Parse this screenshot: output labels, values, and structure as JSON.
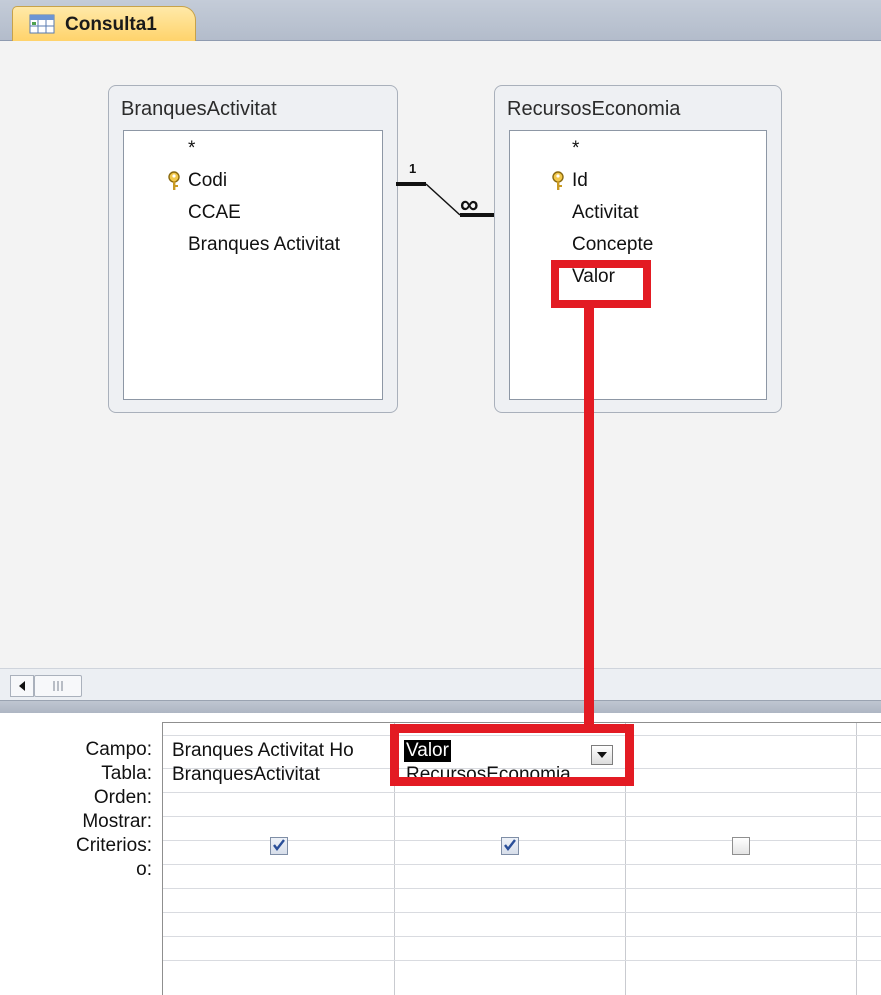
{
  "tab": {
    "title": "Consulta1"
  },
  "tables": [
    {
      "name": "BranquesActivitat",
      "fields": [
        "*",
        "Codi",
        "CCAE",
        "Branques Activitat"
      ],
      "key_field": "Codi"
    },
    {
      "name": "RecursosEconomia",
      "fields": [
        "*",
        "Id",
        "Activitat",
        "Concepte",
        "Valor"
      ],
      "key_field": "Id"
    }
  ],
  "relationship": {
    "one_label": "1",
    "many_label": "∞"
  },
  "grid": {
    "row_labels": [
      "Campo:",
      "Tabla:",
      "Orden:",
      "Mostrar:",
      "Criterios:",
      "o:"
    ],
    "columns": [
      {
        "campo": "Branques Activitat Ho",
        "tabla": "BranquesActivitat",
        "mostrar": true
      },
      {
        "campo": "Valor",
        "tabla": "RecursosEconomia",
        "mostrar": true
      },
      {
        "campo": "",
        "tabla": "",
        "mostrar": false
      }
    ]
  },
  "colors": {
    "highlight": "#e31b23",
    "tab_accent": "#ffd36b"
  },
  "icons": {
    "tab": "query-icon",
    "key": "primary-key-icon",
    "checkmark": "checkmark-icon",
    "dropdown": "chevron-down-icon",
    "scroll_left": "arrow-left-icon"
  }
}
